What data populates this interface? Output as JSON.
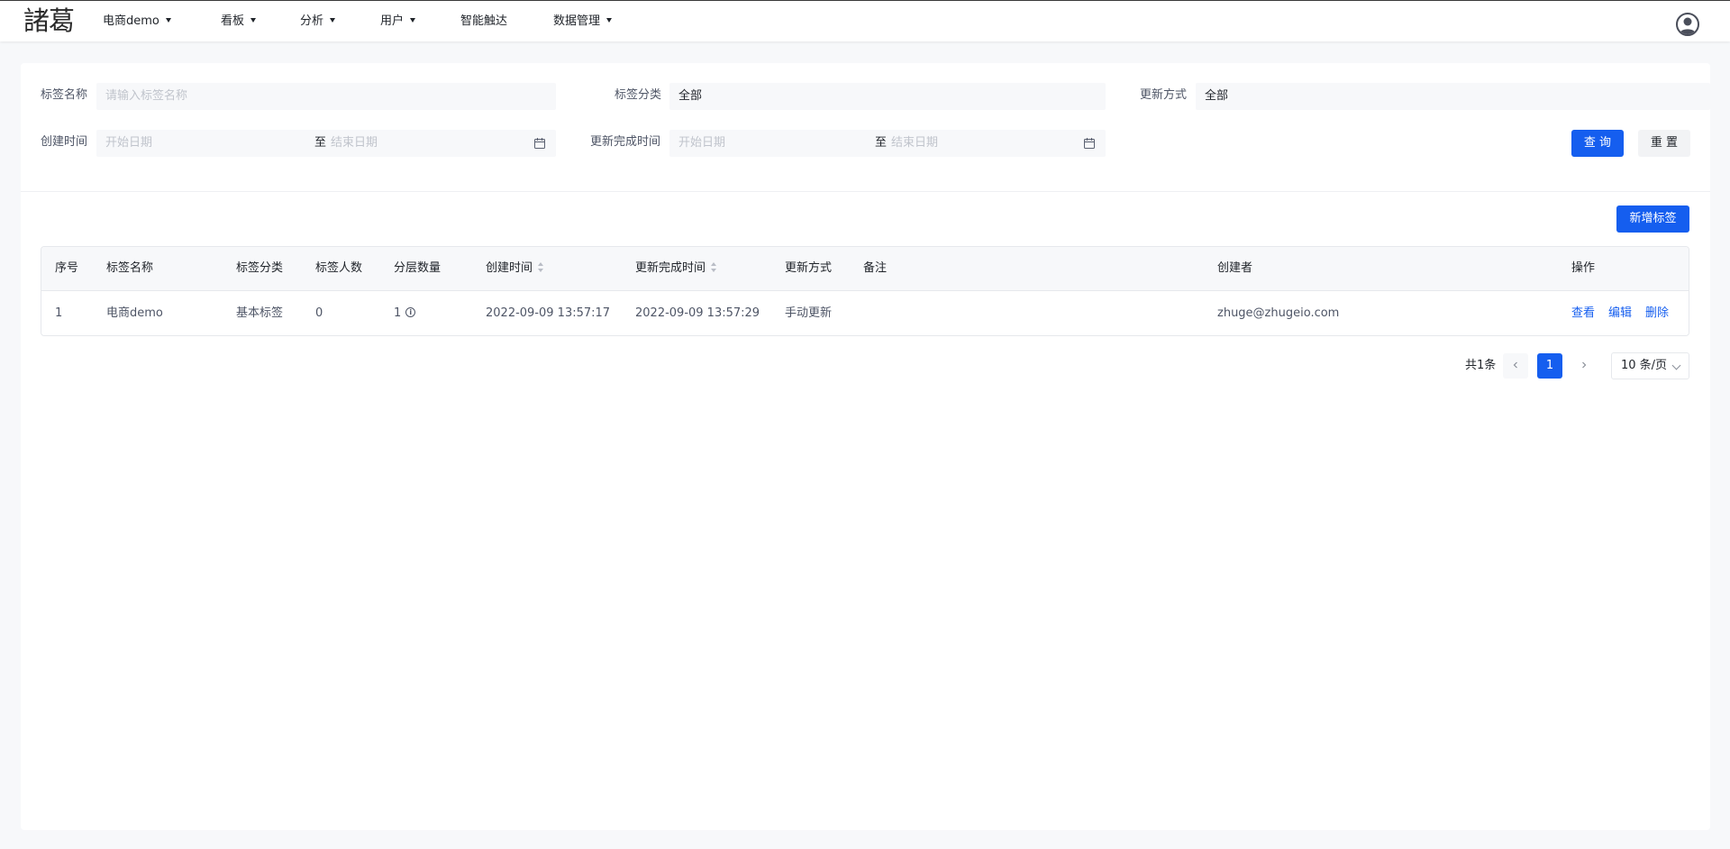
{
  "app": {
    "logo_text": "諸葛"
  },
  "nav": {
    "project": "电商demo",
    "dashboard": "看板",
    "analysis": "分析",
    "users": "用户",
    "smart_reach": "智能触达",
    "data_mgmt": "数据管理"
  },
  "filters": {
    "tag_name": {
      "label": "标签名称",
      "placeholder": "请输入标签名称"
    },
    "tag_category": {
      "label": "标签分类",
      "value": "全部"
    },
    "update_mode": {
      "label": "更新方式",
      "value": "全部"
    },
    "created_time": {
      "label": "创建时间",
      "start_placeholder": "开始日期",
      "separator": "至",
      "end_placeholder": "结束日期"
    },
    "update_done_time": {
      "label": "更新完成时间",
      "start_placeholder": "开始日期",
      "separator": "至",
      "end_placeholder": "结束日期"
    },
    "query_label": "查 询",
    "reset_label": "重 置"
  },
  "toolbar": {
    "add_tag_label": "新增标签"
  },
  "table": {
    "headers": [
      "序号",
      "标签名称",
      "标签分类",
      "标签人数",
      "分层数量",
      "创建时间",
      "更新完成时间",
      "更新方式",
      "备注",
      "创建者",
      "操作"
    ],
    "rows": [
      {
        "index": "1",
        "name": "电商demo",
        "category": "基本标签",
        "people": "0",
        "layers": "1",
        "created": "2022-09-09 13:57:17",
        "updated": "2022-09-09 13:57:29",
        "mode": "手动更新",
        "note": "",
        "creator": "zhuge@zhugeio.com",
        "actions": {
          "view": "查看",
          "edit": "编辑",
          "delete": "删除"
        }
      }
    ]
  },
  "pagination": {
    "total": "共1条",
    "current_page": "1",
    "page_size": "10 条/页"
  },
  "colors": {
    "primary": "#155eef",
    "page_bg": "#f7f8fa",
    "text": "#1f2329",
    "muted": "#4e5566"
  }
}
